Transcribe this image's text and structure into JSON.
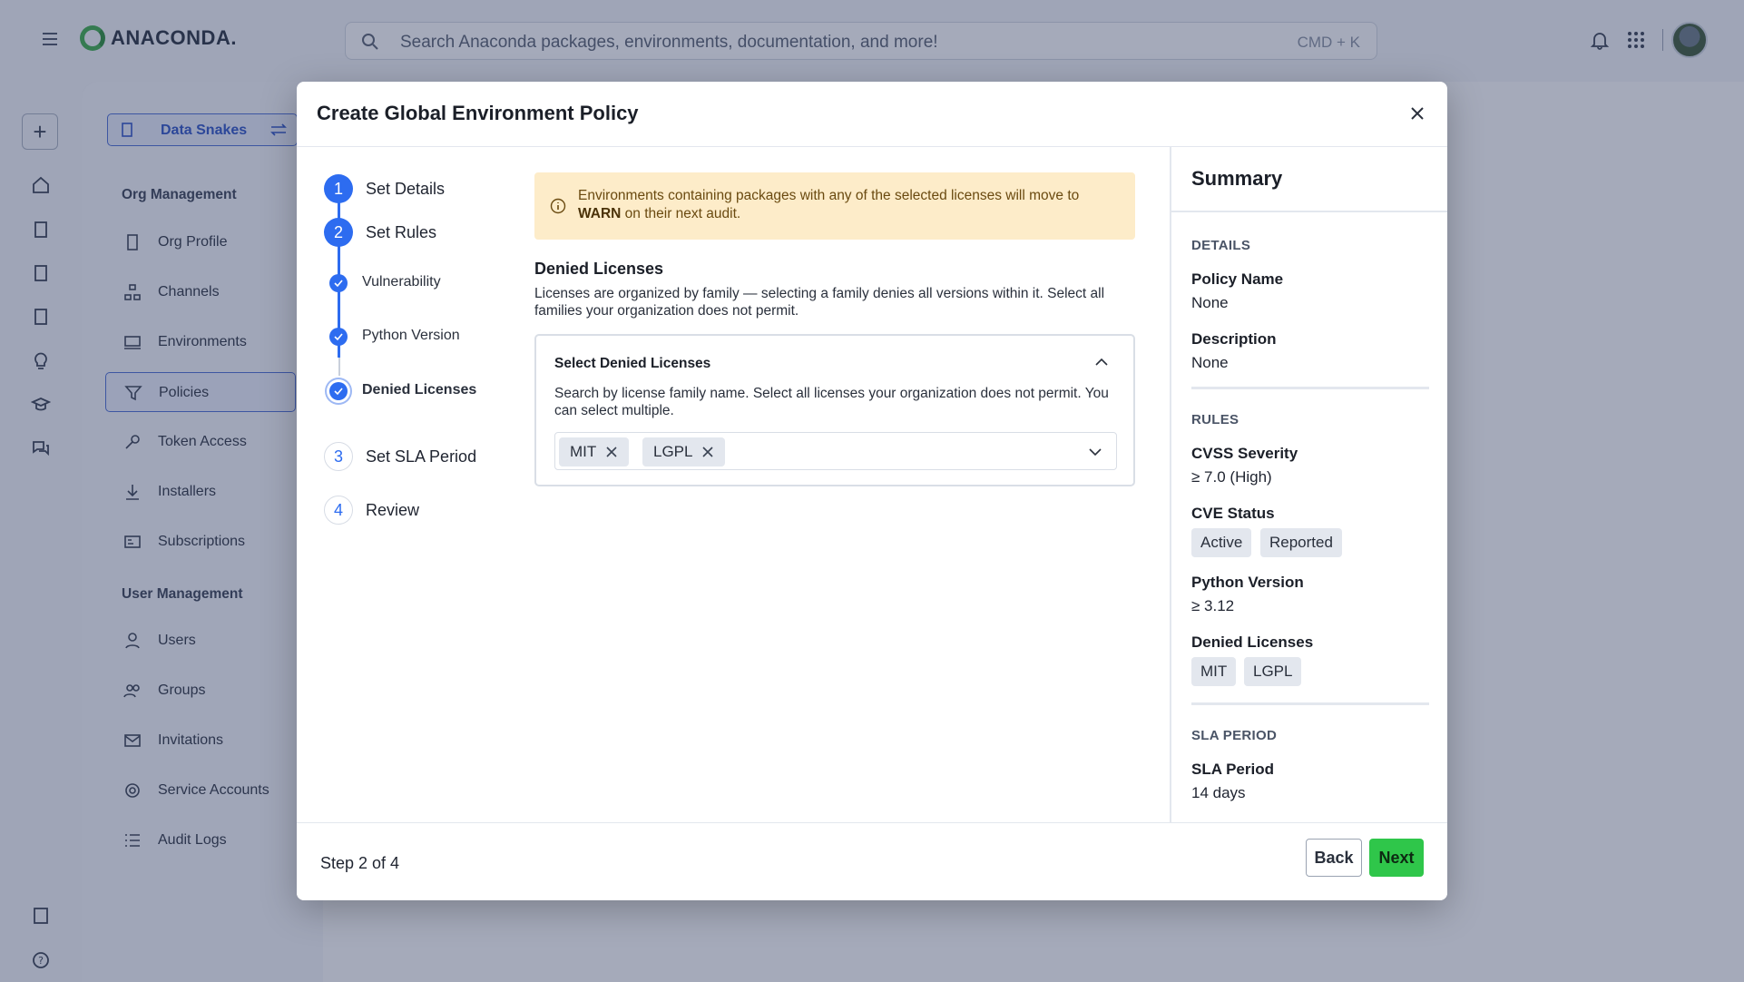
{
  "app": {
    "brand": "ANACONDA.",
    "search": {
      "placeholder": "Search Anaconda packages, environments, documentation, and more!",
      "shortcut": "CMD + K"
    },
    "org_switcher": {
      "label": "Data Snakes"
    },
    "nav": {
      "org_section": "Org Management",
      "org_items": [
        {
          "label": "Org Profile",
          "icon": "building-icon"
        },
        {
          "label": "Channels",
          "icon": "channels-icon"
        },
        {
          "label": "Environments",
          "icon": "environments-icon"
        },
        {
          "label": "Policies",
          "icon": "filter-icon"
        },
        {
          "label": "Token Access",
          "icon": "key-icon"
        },
        {
          "label": "Installers",
          "icon": "download-icon"
        },
        {
          "label": "Subscriptions",
          "icon": "id-card-icon"
        }
      ],
      "user_section": "User Management",
      "user_items": [
        {
          "label": "Users",
          "icon": "user-icon"
        },
        {
          "label": "Groups",
          "icon": "users-icon"
        },
        {
          "label": "Invitations",
          "icon": "mail-icon"
        },
        {
          "label": "Service Accounts",
          "icon": "service-account-icon"
        },
        {
          "label": "Audit Logs",
          "icon": "list-icon"
        }
      ]
    }
  },
  "modal": {
    "title": "Create Global Environment Policy",
    "steps": [
      {
        "num": "1",
        "label": "Set Details"
      },
      {
        "num": "2",
        "label": "Set Rules"
      },
      {
        "num": "3",
        "label": "Set SLA Period"
      },
      {
        "num": "4",
        "label": "Review"
      }
    ],
    "substeps": [
      {
        "label": "Vulnerability"
      },
      {
        "label": "Python Version"
      },
      {
        "label": "Denied Licenses"
      }
    ],
    "alert": {
      "text_before": "Environments containing packages with any of the selected licenses will move to ",
      "text_bold": "WARN",
      "text_after": " on their next audit."
    },
    "section_title": "Denied Licenses",
    "section_desc": "Licenses are organized by family — selecting a family denies all versions within it. Select all families your organization does not permit.",
    "select_card": {
      "title": "Select Denied Licenses",
      "desc": "Search by license family name. Select all licenses your organization does not permit. You can select multiple.",
      "chips": [
        "MIT",
        "LGPL"
      ]
    },
    "summary": {
      "title": "Summary",
      "details_heading": "DETAILS",
      "policy_name_key": "Policy Name",
      "policy_name_val": "None",
      "description_key": "Description",
      "description_val": "None",
      "rules_heading": "RULES",
      "cvss_key": "CVSS Severity",
      "cvss_val": "≥ 7.0 (High)",
      "cve_key": "CVE Status",
      "cve_tags": [
        "Active",
        "Reported"
      ],
      "python_key": "Python Version",
      "python_val": "≥ 3.12",
      "licenses_key": "Denied Licenses",
      "license_tags": [
        "MIT",
        "LGPL"
      ],
      "sla_heading": "SLA PERIOD",
      "sla_key": "SLA Period",
      "sla_val": "14 days"
    },
    "footer": {
      "step_counter": "Step 2 of 4",
      "back_label": "Back",
      "next_label": "Next"
    }
  },
  "colors": {
    "primary": "#2d6cf0",
    "success": "#2fc64a",
    "warning_bg": "#fdecc9"
  }
}
